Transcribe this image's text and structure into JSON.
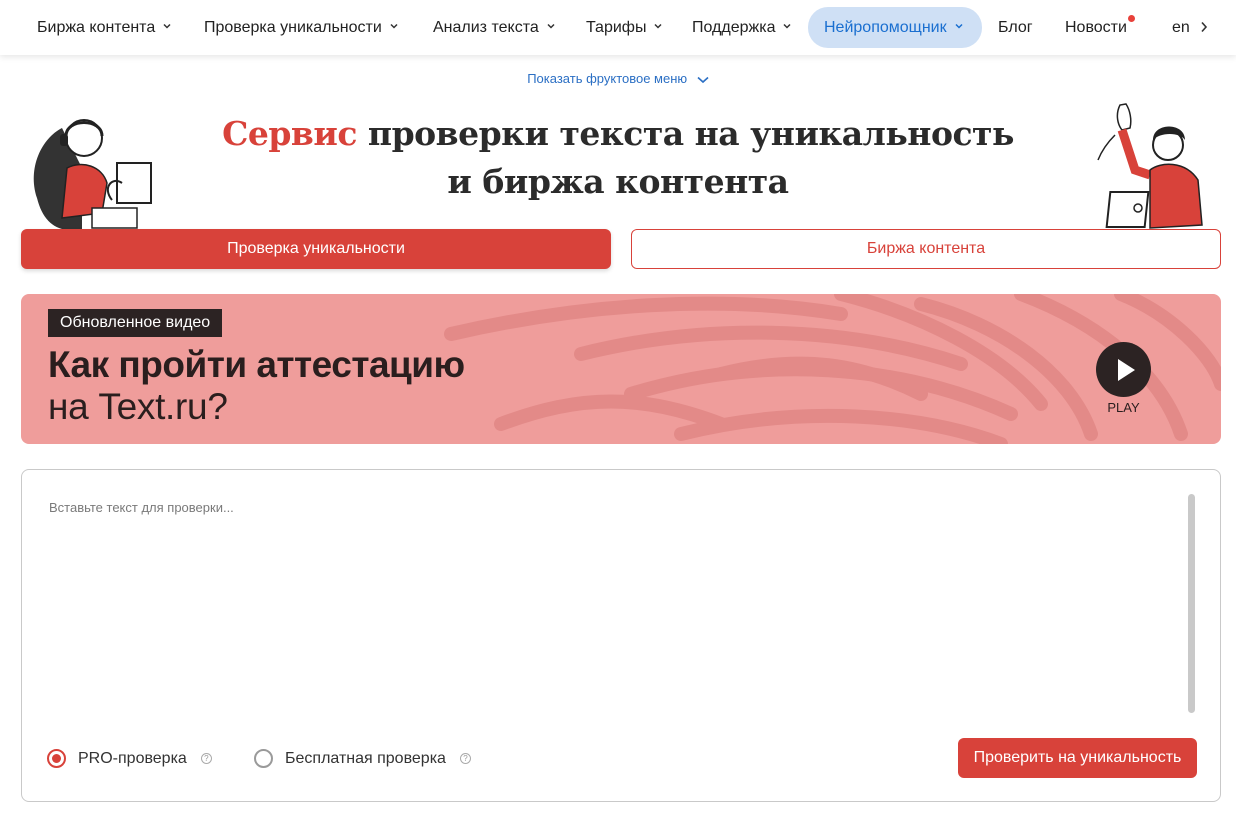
{
  "nav": {
    "items": [
      {
        "label": "Биржа контента",
        "has_dropdown": true
      },
      {
        "label": "Проверка уникальности",
        "has_dropdown": true
      },
      {
        "label": "Анализ текста",
        "has_dropdown": true
      },
      {
        "label": "Тарифы",
        "has_dropdown": true
      },
      {
        "label": "Поддержка",
        "has_dropdown": true
      },
      {
        "label": "Нейропомощник",
        "has_dropdown": true,
        "active": true
      },
      {
        "label": "Блог",
        "has_dropdown": false
      },
      {
        "label": "Новости",
        "has_dropdown": false,
        "notification_dot": true
      }
    ],
    "language": "en",
    "next_icon": "chevron-right-icon"
  },
  "fruit_menu": {
    "label": "Показать фруктовое меню",
    "icon": "chevron-down-icon"
  },
  "hero": {
    "title_accent": "Сервис",
    "title_rest": "проверки текста на уникальность",
    "title_line2": "и биржа контента"
  },
  "tabs": {
    "primary": "Проверка уникальности",
    "secondary": "Биржа контента"
  },
  "banner": {
    "tag": "Обновленное видео",
    "headline": "Как пройти аттестацию",
    "subline": "на Text.ru?",
    "play_label": "PLAY"
  },
  "checker": {
    "placeholder": "Вставьте текст для проверки...",
    "option_pro": "PRO-проверка",
    "option_free": "Бесплатная проверка",
    "selected": "pro",
    "submit": "Проверить на уникальность"
  },
  "colors": {
    "accent": "#d8423a",
    "banner_bg": "#ef9d9b",
    "active_nav_bg": "#cfe0f5",
    "active_nav_text": "#1a6fd0",
    "link": "#2b6fc4"
  }
}
